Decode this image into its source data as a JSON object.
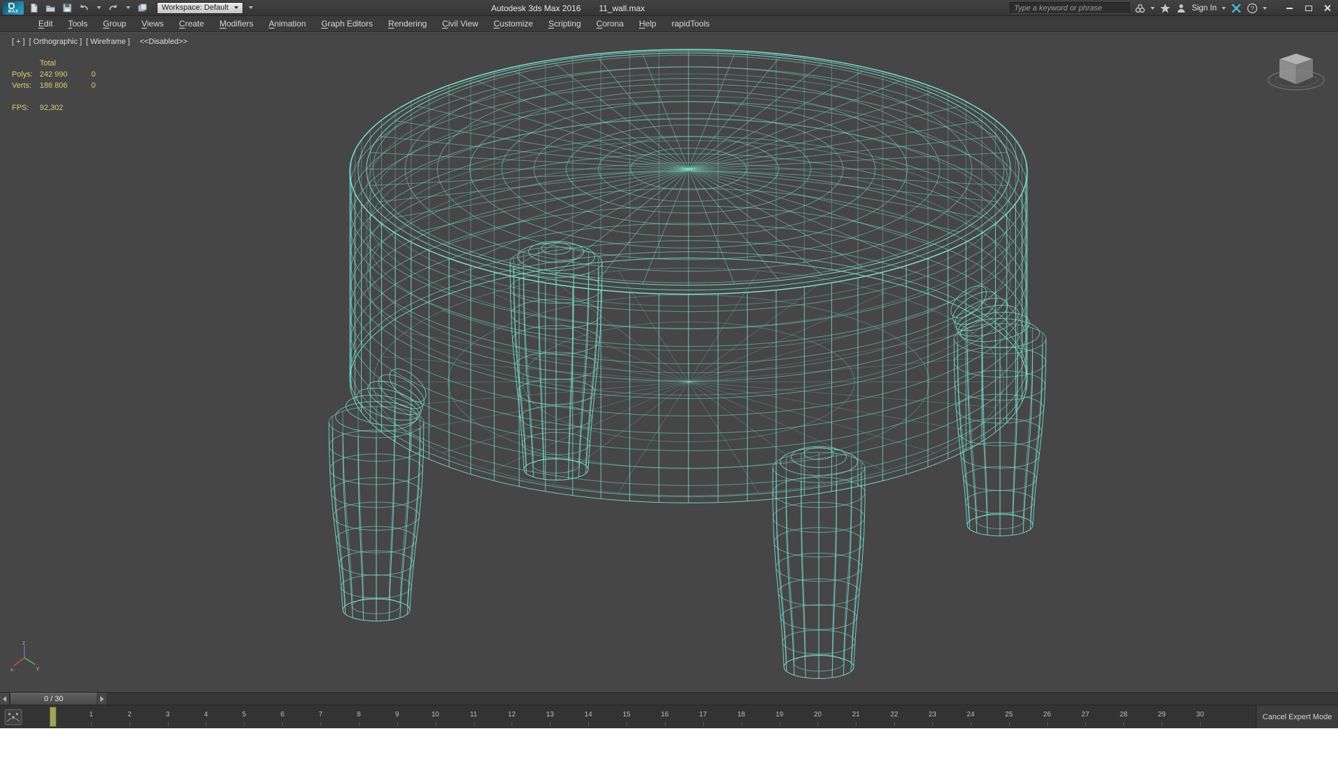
{
  "titlebar": {
    "logo_text": "MAX",
    "workspace": {
      "label": "Workspace: Default"
    },
    "app_title": "Autodesk 3ds Max 2016",
    "file_name": "11_wall.max",
    "search": {
      "placeholder": "Type a keyword or phrase"
    },
    "sign_in_label": "Sign In"
  },
  "menubar": {
    "items": [
      {
        "label": "Edit",
        "u": 0
      },
      {
        "label": "Tools",
        "u": 0
      },
      {
        "label": "Group",
        "u": 0
      },
      {
        "label": "Views",
        "u": 0
      },
      {
        "label": "Create",
        "u": 0
      },
      {
        "label": "Modifiers",
        "u": 0
      },
      {
        "label": "Animation",
        "u": 0
      },
      {
        "label": "Graph Editors",
        "u": 0
      },
      {
        "label": "Rendering",
        "u": 0
      },
      {
        "label": "Civil View",
        "u": 0
      },
      {
        "label": "Customize",
        "u": 0
      },
      {
        "label": "Scripting",
        "u": 0
      },
      {
        "label": "Corona",
        "u": 0
      },
      {
        "label": "Help",
        "u": 0
      },
      {
        "label": "rapidTools",
        "u": -1
      }
    ]
  },
  "viewport": {
    "label": {
      "general": "[ + ]",
      "pov": "[ Orthographic ]",
      "shading": "[ Wireframe ]",
      "status": "<<Disabled>>"
    },
    "stats": {
      "column_header": "Total",
      "rows": [
        {
          "label": "Polys:",
          "total": "242 990",
          "selected": "0"
        },
        {
          "label": "Verts:",
          "total": "186 806",
          "selected": "0"
        }
      ],
      "fps_label": "FPS:",
      "fps_value": "92,302"
    },
    "axis_labels": {
      "x": "x",
      "y": "y",
      "z": "z"
    },
    "model": {
      "name": "wireframe-round-table",
      "color": "#7ee8d2"
    }
  },
  "timeline": {
    "current_frame": "0 / 30",
    "frame_labels": [
      "1",
      "2",
      "3",
      "4",
      "5",
      "6",
      "7",
      "8",
      "9",
      "10",
      "11",
      "12",
      "13",
      "14",
      "15",
      "16",
      "17",
      "18",
      "19",
      "20",
      "21",
      "22",
      "23",
      "24",
      "25",
      "26",
      "27",
      "28",
      "29",
      "30"
    ],
    "cancel_expert_label": "Cancel Expert Mode"
  }
}
